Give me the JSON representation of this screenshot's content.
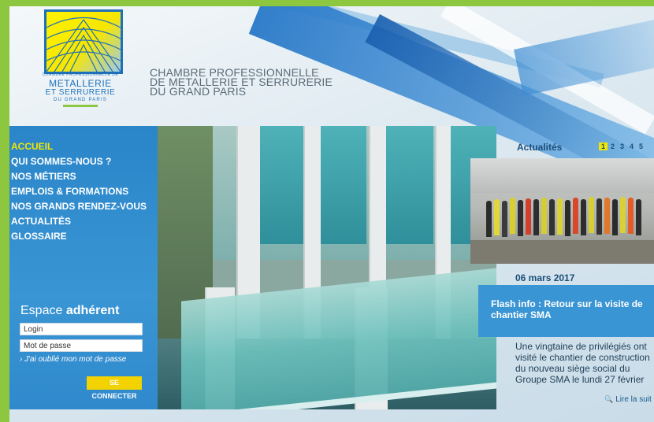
{
  "brand": {
    "logo_small": "CHAMBRE PROFESSIONNELLE DE",
    "logo_line1": "METALLERIE",
    "logo_line2": "ET SERRURERIE",
    "logo_line3": "DU GRAND PARIS",
    "tagline": [
      "CHAMBRE PROFESSIONNELLE",
      "DE METALLERIE ET SERRURERIE",
      "DU GRAND PARIS"
    ]
  },
  "nav": {
    "items": [
      {
        "label": "ACCUEIL",
        "active": true
      },
      {
        "label": "QUI SOMMES-NOUS ?"
      },
      {
        "label": "NOS MÉTIERS"
      },
      {
        "label": "EMPLOIS & FORMATIONS"
      },
      {
        "label": "NOS GRANDS RENDEZ-VOUS"
      },
      {
        "label": "ACTUALITÉS"
      },
      {
        "label": "GLOSSAIRE"
      }
    ]
  },
  "member": {
    "title_light": "Espace",
    "title_bold": "adhérent",
    "login_placeholder": "Login",
    "password_placeholder": "Mot de passe",
    "forgot": "› J'ai oublié mon mot de passe",
    "connect_label": "SE CONNECTER"
  },
  "news": {
    "heading": "Actualités",
    "pages": [
      "1",
      "2",
      "3",
      "4",
      "5"
    ],
    "active_page": "1",
    "date": "06 mars 2017",
    "title": "Flash info : Retour sur la visite de chantier SMA",
    "excerpt": "Une vingtaine de privilégiés ont visité le chantier de construction du nouveau siège social du Groupe SMA le lundi 27 février",
    "read_more": "Lire la suit"
  },
  "icons": {
    "read_more": "magnifier-icon"
  },
  "colors": {
    "accent_green": "#8dc63f",
    "accent_blue": "#2a85c9",
    "accent_yellow": "#f2e600"
  }
}
